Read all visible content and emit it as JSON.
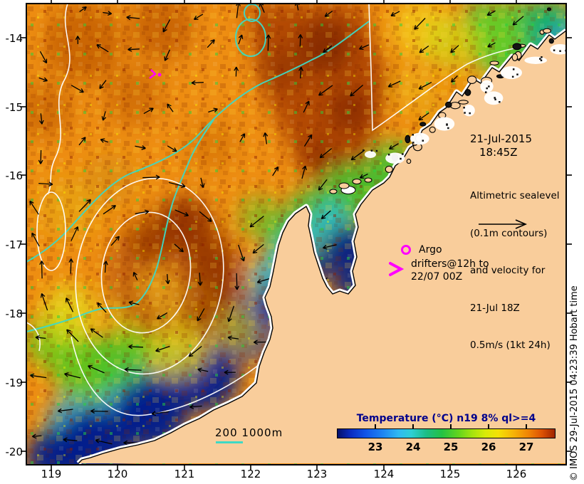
{
  "annotations": {
    "datetime": {
      "line1": "21-Jul-2015",
      "line2": "18:45Z"
    },
    "altimetric": {
      "lines": [
        "Altimetric sealevel",
        "(0.1m contours)",
        "and velocity for",
        "21-Jul 18Z",
        "0.5m/s (1kt 24h)"
      ]
    },
    "argo": {
      "label": "Argo",
      "marker": "magenta-circle"
    },
    "drifters": {
      "symbol": ">",
      "line1": "drifters@12h to",
      "line2": "22/07 00Z",
      "marker": "magenta-chevron"
    },
    "bathymetry_legend": {
      "label": "200 1000m"
    }
  },
  "colorbar": {
    "title": "Temperature (°C) n19 8% ql>=4",
    "tick_labels": [
      "23",
      "24",
      "25",
      "26",
      "27"
    ],
    "gradient_stops": [
      "#04106a",
      "#1155e8",
      "#2fb9f2",
      "#1dbd84",
      "#23c244",
      "#a5e30e",
      "#f4e106",
      "#f6b307",
      "#dd5203",
      "#a02400"
    ]
  },
  "axes": {
    "x_tick_labels": [
      "119",
      "120",
      "121",
      "122",
      "123",
      "124",
      "125",
      "126"
    ],
    "y_tick_labels": [
      "-14",
      "-15",
      "-16",
      "-17",
      "-18",
      "-19",
      "-20"
    ]
  },
  "credit": "© IMOS 29-Jul-2015 04:23:39 Hobart time",
  "colors": {
    "land": "#f9cd9b",
    "marker_magenta": "#ff00ff",
    "bathy_contour_cyan": "#3fd9c4",
    "sealevel_contour_white": "#ffffff",
    "colorbar_title_navy": "#00008b",
    "deep_water_navy": "#001a8c"
  }
}
